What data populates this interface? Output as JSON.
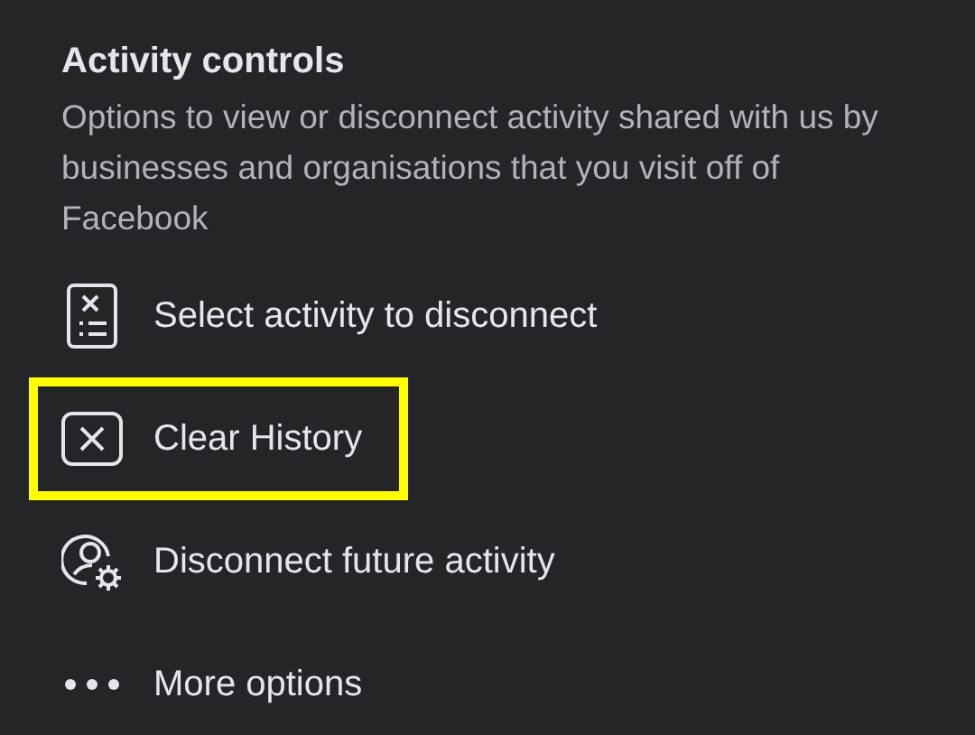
{
  "section": {
    "title": "Activity controls",
    "description": "Options to view or disconnect activity shared with us by businesses and organisations that you visit off of Facebook"
  },
  "items": [
    {
      "kind": "select",
      "label": "Select activity to disconnect",
      "highlighted": false
    },
    {
      "kind": "clear",
      "label": "Clear History",
      "highlighted": true
    },
    {
      "kind": "disconnect",
      "label": "Disconnect future activity",
      "highlighted": false
    },
    {
      "kind": "more",
      "label": "More options",
      "highlighted": false
    }
  ]
}
